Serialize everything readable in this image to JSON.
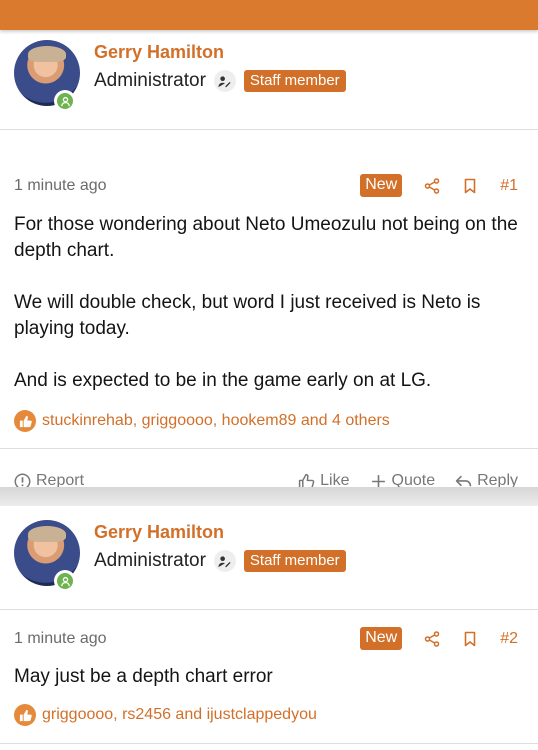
{
  "colors": {
    "accent": "#d2702a",
    "topbar": "#d97a2f",
    "online": "#6fb351"
  },
  "posts": [
    {
      "author": {
        "name": "Gerry Hamilton",
        "role": "Administrator",
        "badge": "Staff member"
      },
      "time": "1 minute ago",
      "new_label": "New",
      "number": "#1",
      "body": [
        "For those wondering about Neto Umeozulu not being on the depth chart.",
        "We will double check, but word I just received is Neto is playing today.",
        "And is expected to be in the game early on at LG."
      ],
      "reactions": "stuckinrehab, griggoooo, hookem89 and 4 others",
      "actions": {
        "report": "Report",
        "like": "Like",
        "quote": "Quote",
        "reply": "Reply"
      }
    },
    {
      "author": {
        "name": "Gerry Hamilton",
        "role": "Administrator",
        "badge": "Staff member"
      },
      "time": "1 minute ago",
      "new_label": "New",
      "number": "#2",
      "body": [
        "May just be a depth chart error"
      ],
      "reactions": "griggoooo, rs2456 and ijustclappedyou"
    }
  ],
  "icons": [
    "user-online-icon",
    "admin-icon",
    "share-icon",
    "bookmark-icon",
    "like-icon",
    "report-icon",
    "thumbs-up-icon",
    "plus-icon",
    "reply-icon"
  ]
}
